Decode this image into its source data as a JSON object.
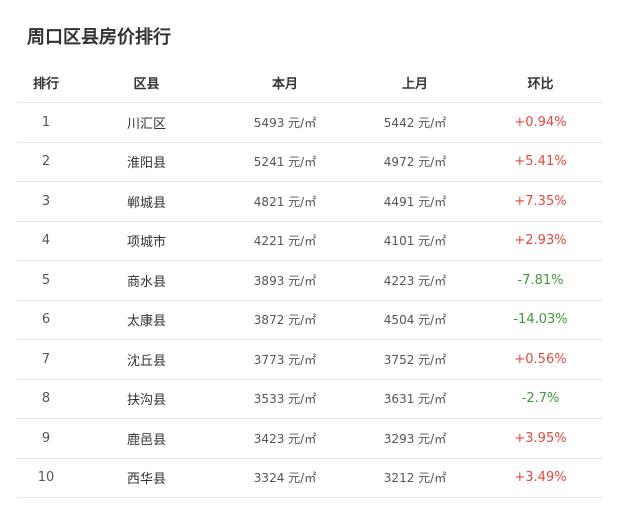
{
  "title": "周口区县房价排行",
  "colors": {
    "up": "#e8473e",
    "down": "#3d9a36",
    "divider": "#e6e6e6"
  },
  "table": {
    "headers": {
      "rank": "排行",
      "district": "区县",
      "this_month": "本月",
      "last_month": "上月",
      "change": "环比"
    },
    "rows": [
      {
        "rank": "1",
        "district": "川汇区",
        "this_month": "5493 元/㎡",
        "last_month": "5442 元/㎡",
        "change": "+0.94%",
        "direction": "up"
      },
      {
        "rank": "2",
        "district": "淮阳县",
        "this_month": "5241 元/㎡",
        "last_month": "4972 元/㎡",
        "change": "+5.41%",
        "direction": "up"
      },
      {
        "rank": "3",
        "district": "郸城县",
        "this_month": "4821 元/㎡",
        "last_month": "4491 元/㎡",
        "change": "+7.35%",
        "direction": "up"
      },
      {
        "rank": "4",
        "district": "项城市",
        "this_month": "4221 元/㎡",
        "last_month": "4101 元/㎡",
        "change": "+2.93%",
        "direction": "up"
      },
      {
        "rank": "5",
        "district": "商水县",
        "this_month": "3893 元/㎡",
        "last_month": "4223 元/㎡",
        "change": "-7.81%",
        "direction": "down"
      },
      {
        "rank": "6",
        "district": "太康县",
        "this_month": "3872 元/㎡",
        "last_month": "4504 元/㎡",
        "change": "-14.03%",
        "direction": "down"
      },
      {
        "rank": "7",
        "district": "沈丘县",
        "this_month": "3773 元/㎡",
        "last_month": "3752 元/㎡",
        "change": "+0.56%",
        "direction": "up"
      },
      {
        "rank": "8",
        "district": "扶沟县",
        "this_month": "3533 元/㎡",
        "last_month": "3631 元/㎡",
        "change": "-2.7%",
        "direction": "down"
      },
      {
        "rank": "9",
        "district": "鹿邑县",
        "this_month": "3423 元/㎡",
        "last_month": "3293 元/㎡",
        "change": "+3.95%",
        "direction": "up"
      },
      {
        "rank": "10",
        "district": "西华县",
        "this_month": "3324 元/㎡",
        "last_month": "3212 元/㎡",
        "change": "+3.49%",
        "direction": "up"
      }
    ]
  }
}
